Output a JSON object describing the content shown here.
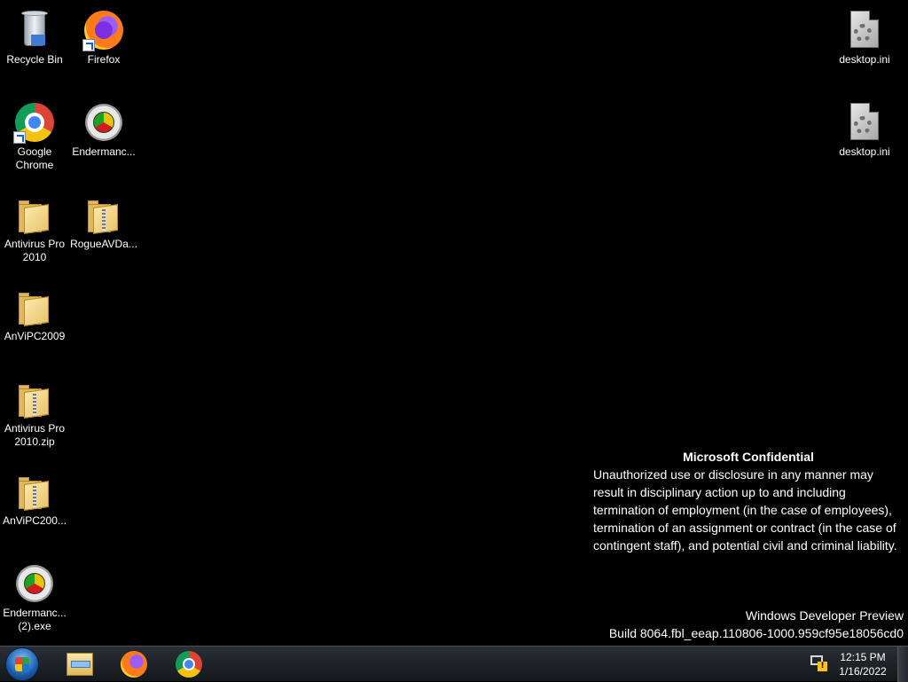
{
  "desktop": {
    "icons": [
      {
        "label": "Recycle Bin",
        "icon": "recycle-bin-icon"
      },
      {
        "label": "Firefox",
        "icon": "firefox-icon",
        "shortcut": true
      },
      {
        "label": "Google Chrome",
        "icon": "chrome-icon",
        "shortcut": true
      },
      {
        "label": "Endermanc...",
        "icon": "endermanch-icon"
      },
      {
        "label": "Antivirus Pro 2010",
        "icon": "folder-icon"
      },
      {
        "label": "RogueAVDa...",
        "icon": "zip-folder-icon"
      },
      {
        "label": "AnViPC2009",
        "icon": "folder-icon"
      },
      {
        "label": "Antivirus Pro 2010.zip",
        "icon": "zip-folder-icon"
      },
      {
        "label": "AnViPC200...",
        "icon": "zip-folder-icon"
      },
      {
        "label": "Endermanc... (2).exe",
        "icon": "endermanch-icon"
      },
      {
        "label": "desktop.ini",
        "icon": "config-file-icon"
      },
      {
        "label": "desktop.ini",
        "icon": "config-file-icon"
      }
    ]
  },
  "notice": {
    "heading": "Microsoft Confidential",
    "body": "Unauthorized use or disclosure in any manner may result in disciplinary action up to and including termination of employment (in the case of employees), termination of an assignment or contract (in the case of contingent staff), and potential civil and criminal liability."
  },
  "watermark": {
    "line1": "Windows Developer Preview",
    "line2": "Build 8064.fbl_eeap.110806-1000.959cf95e18056cd0"
  },
  "taskbar": {
    "pinned": [
      {
        "name": "Windows Explorer",
        "icon": "explorer-icon"
      },
      {
        "name": "Firefox",
        "icon": "firefox-icon"
      },
      {
        "name": "Google Chrome",
        "icon": "chrome-icon"
      }
    ],
    "tray": {
      "time": "12:15 PM",
      "date": "1/16/2022",
      "network_status": "!"
    }
  }
}
